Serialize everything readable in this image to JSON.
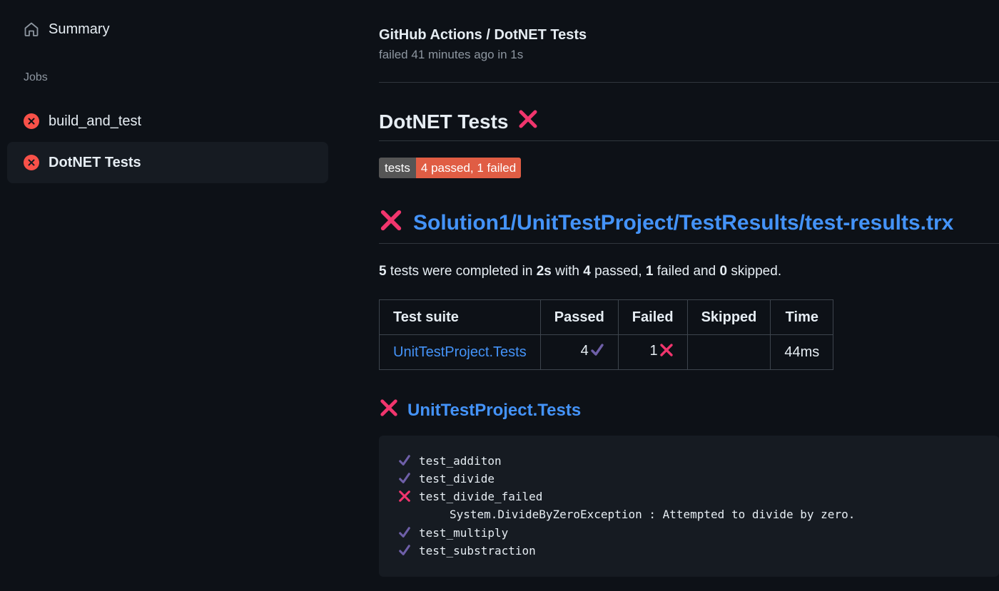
{
  "sidebar": {
    "summary_label": "Summary",
    "jobs_heading": "Jobs",
    "jobs": [
      {
        "label": "build_and_test",
        "status": "failed",
        "active": false
      },
      {
        "label": "DotNET Tests",
        "status": "failed",
        "active": true
      }
    ]
  },
  "header": {
    "title": "GitHub Actions / DotNET Tests",
    "subtitle": "failed 41 minutes ago in 1s"
  },
  "report": {
    "heading": "DotNET Tests",
    "heading_mark": "❌",
    "badge": {
      "label": "tests",
      "value": "4 passed, 1 failed"
    },
    "file_heading": "Solution1/UnitTestProject/TestResults/test-results.trx",
    "summary": {
      "total": "5",
      "text1": " tests were completed in ",
      "duration": "2s",
      "text2": " with ",
      "passed": "4",
      "text3": " passed, ",
      "failed": "1",
      "text4": " failed and ",
      "skipped": "0",
      "text5": " skipped."
    },
    "table": {
      "headers": [
        "Test suite",
        "Passed",
        "Failed",
        "Skipped",
        "Time"
      ],
      "rows": [
        {
          "suite": "UnitTestProject.Tests",
          "passed": "4",
          "failed": "1",
          "skipped": "",
          "time": "44ms"
        }
      ]
    },
    "suite_heading": "UnitTestProject.Tests",
    "tests": [
      {
        "name": "test_additon",
        "status": "passed"
      },
      {
        "name": "test_divide",
        "status": "passed"
      },
      {
        "name": "test_divide_failed",
        "status": "failed",
        "detail": "System.DivideByZeroException : Attempted to divide by zero."
      },
      {
        "name": "test_multiply",
        "status": "passed"
      },
      {
        "name": "test_substraction",
        "status": "passed"
      }
    ]
  },
  "colors": {
    "background": "#0d1117",
    "link": "#4493f8",
    "error": "#f85149",
    "cross": "#f1356d",
    "check": "#6e5fa8",
    "badge_fail": "#e05d44"
  },
  "icons": {
    "summary": "home-icon",
    "job_status": "x-circle-fill-icon",
    "fail_mark": "cross-mark-icon",
    "pass_mark": "check-mark-icon"
  }
}
